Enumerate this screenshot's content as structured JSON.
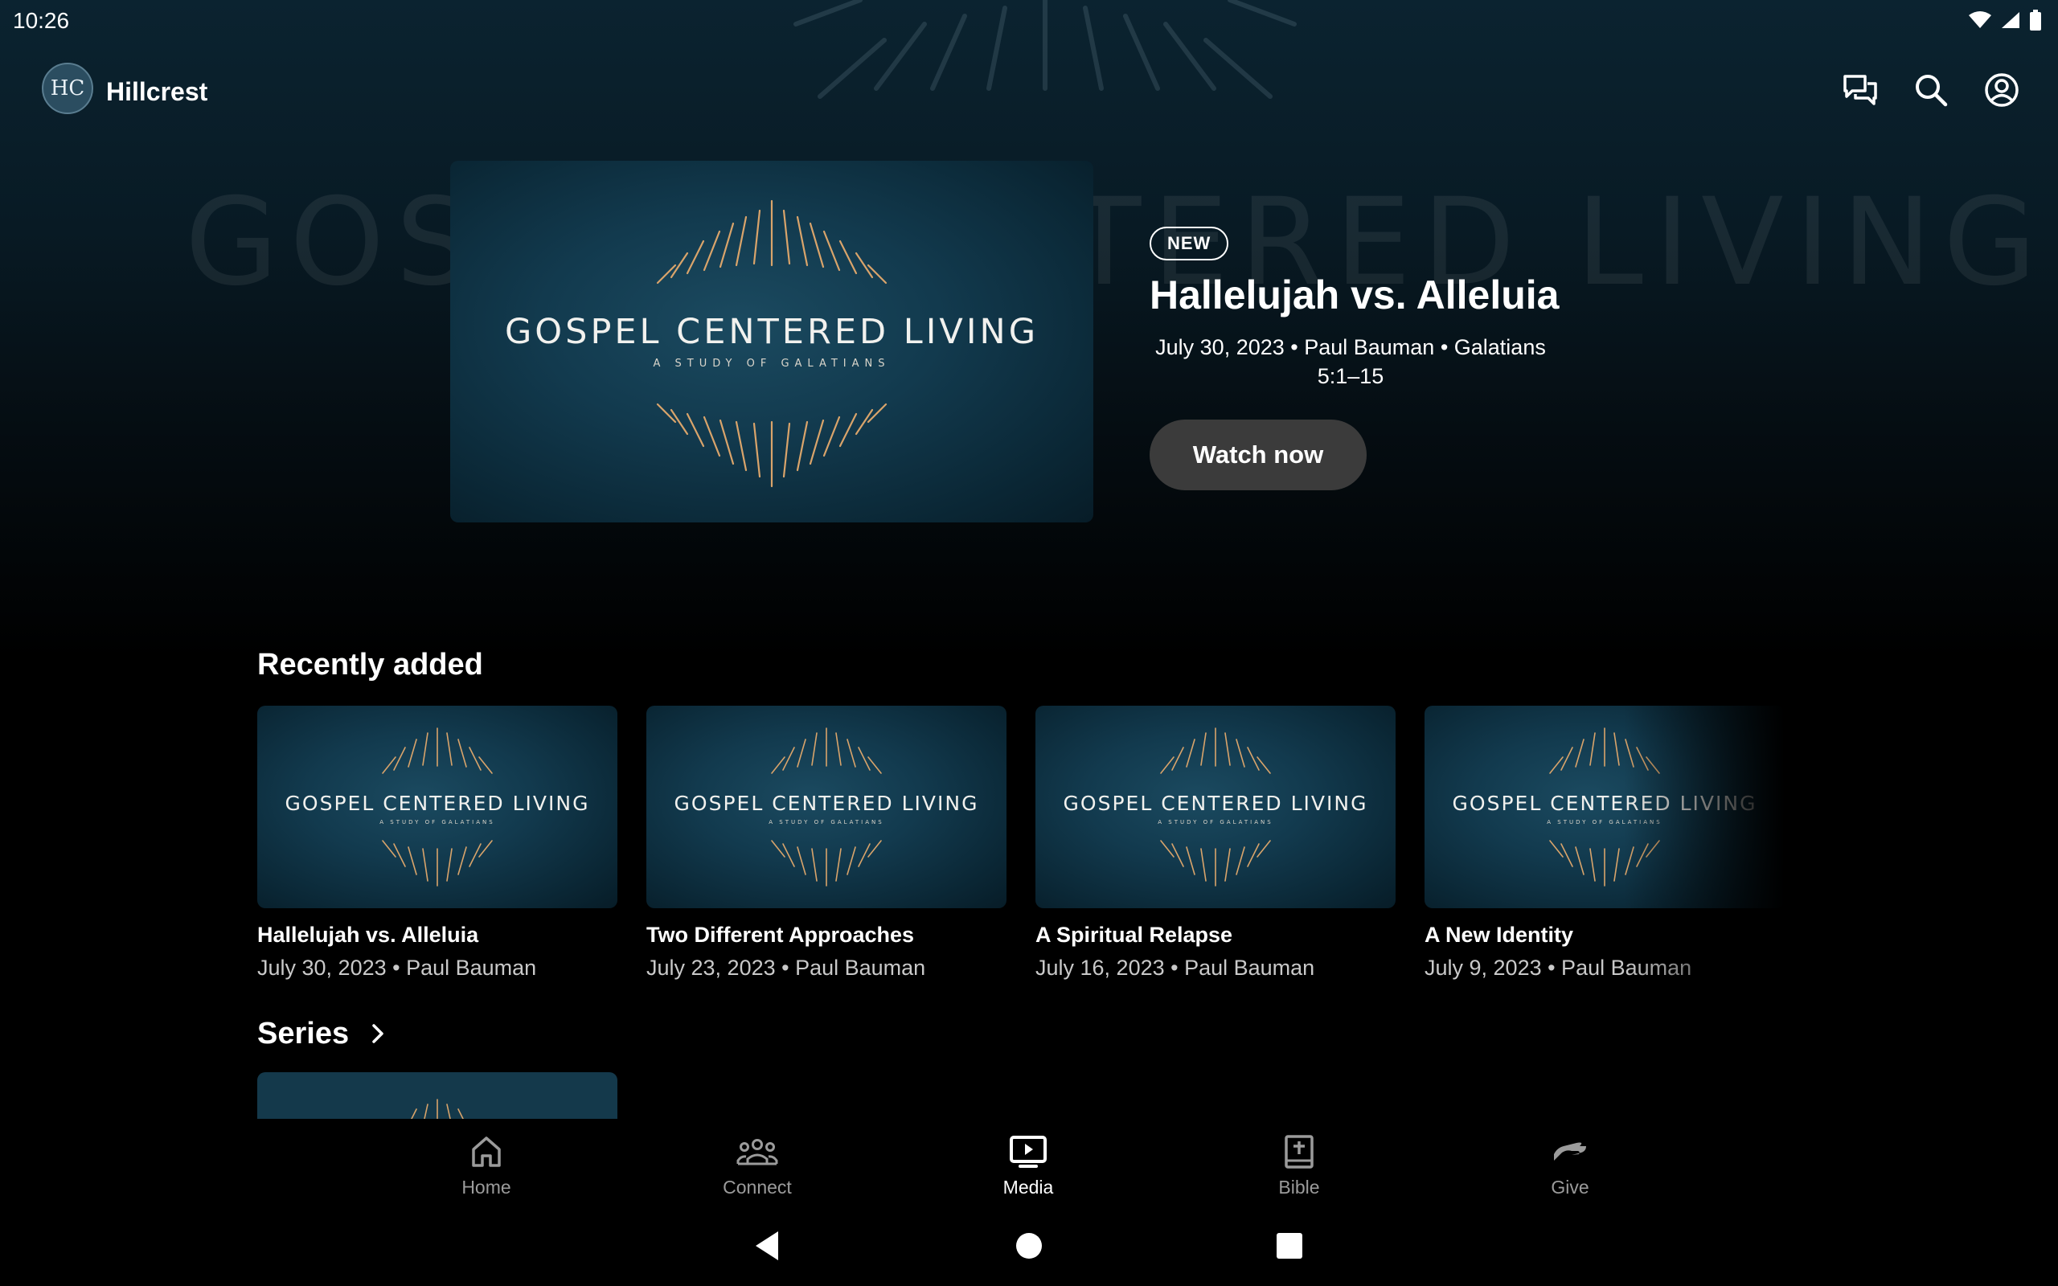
{
  "status_bar": {
    "time": "10:26"
  },
  "app_bar": {
    "logo_text": "HC",
    "brand_name": "Hillcrest",
    "icons": [
      "chat-icon",
      "search-icon",
      "account-icon"
    ]
  },
  "hero": {
    "watermark": "GOSPEL CENTERED LIVING",
    "art_title": "GOSPEL CENTERED LIVING",
    "art_subtitle": "A STUDY OF GALATIANS",
    "badge": "NEW",
    "title": "Hallelujah vs. Alleluia",
    "meta": "July 30, 2023 • Paul Bauman • Galatians 5:1–15",
    "watch_label": "Watch now"
  },
  "recently_added": {
    "heading": "Recently added",
    "items": [
      {
        "title": "Hallelujah vs. Alleluia",
        "meta": "July 30, 2023 • Paul Bauman",
        "art_title": "GOSPEL CENTERED LIVING",
        "art_subtitle": "A STUDY OF GALATIANS"
      },
      {
        "title": "Two Different Approaches",
        "meta": "July 23, 2023 • Paul Bauman",
        "art_title": "GOSPEL CENTERED LIVING",
        "art_subtitle": "A STUDY OF GALATIANS"
      },
      {
        "title": "A Spiritual Relapse",
        "meta": "July 16, 2023 • Paul Bauman",
        "art_title": "GOSPEL CENTERED LIVING",
        "art_subtitle": "A STUDY OF GALATIANS"
      },
      {
        "title": "A New Identity",
        "meta": "July 9, 2023 • Paul Bauman",
        "art_title": "GOSPEL CENTERED LIVING",
        "art_subtitle": "A STUDY OF GALATIANS"
      }
    ]
  },
  "series": {
    "heading": "Series"
  },
  "bottom_nav": {
    "items": [
      {
        "label": "Home",
        "icon": "home-icon",
        "active": false
      },
      {
        "label": "Connect",
        "icon": "people-icon",
        "active": false
      },
      {
        "label": "Media",
        "icon": "media-icon",
        "active": true
      },
      {
        "label": "Bible",
        "icon": "bible-icon",
        "active": false
      },
      {
        "label": "Give",
        "icon": "give-icon",
        "active": false
      }
    ]
  },
  "colors": {
    "background": "#000000",
    "hero_top": "#0b2330",
    "art_blue": "#123a4e",
    "art_gold": "#d9a46b",
    "button_bg": "#3b3b3b",
    "inactive_label": "#9b9b9b"
  }
}
